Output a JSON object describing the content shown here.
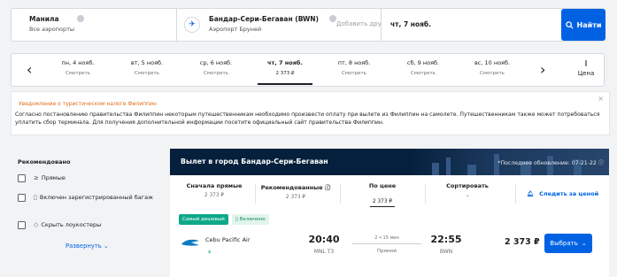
{
  "search": {
    "origin": {
      "city": "Манила",
      "sub": "Все аэропорты"
    },
    "destination": {
      "city": "Бандар-Сери-Бегаван (BWN)",
      "sub": "Аэропорт Бруней"
    },
    "add_placeholder": "Добавить дру",
    "date": "чт, 7 нояб.",
    "button_label": "Найти"
  },
  "date_strip": {
    "days": [
      {
        "date": "пн, 4 нояб.",
        "price": "Смотреть"
      },
      {
        "date": "вт, 5 нояб.",
        "price": "Смотреть"
      },
      {
        "date": "ср, 6 нояб.",
        "price": "Смотреть"
      },
      {
        "date": "чт, 7 нояб.",
        "price": "2 373 ₽"
      },
      {
        "date": "пт, 8 нояб.",
        "price": "Смотреть"
      },
      {
        "date": "сб, 9 нояб.",
        "price": "Смотреть"
      },
      {
        "date": "вс, 10 нояб.",
        "price": "Смотреть"
      }
    ],
    "active_index": 3,
    "price_chart_label": "Цена"
  },
  "notice": {
    "title": "Уведомление о туристическом налоге Филиппин",
    "body": "Согласно постановлению правительства Филиппин некоторым путешественникам необходимо произвести оплату при вылете из Филиппин на самолете. Путешественникам также может потребоваться уплатить сбор терминала. Для получения дополнительной информации посетите официальный сайт правительства Филиппин."
  },
  "filters": {
    "title": "Рекомендовано",
    "items": [
      {
        "label": "Прямые",
        "icon": "direct-flight-icon"
      },
      {
        "label": "Включен зарегистрированный багаж",
        "icon": "luggage-icon"
      },
      {
        "label": "Скрыть лоукостеры",
        "icon": "tag-icon"
      }
    ],
    "expand_label": "Развернуть"
  },
  "results": {
    "banner_title": "Вылет в город Бандар-Сери-Бегаван",
    "last_update": "*Последнее обновление: 07-21-22",
    "sort_tabs": [
      {
        "label": "Сначала прямые",
        "value": "2 373 ₽"
      },
      {
        "label": "Рекомендованные",
        "value": "2 373 ₽"
      },
      {
        "label": "По цене",
        "value": "2 373 ₽"
      },
      {
        "label": "Сортировать",
        "value": ""
      }
    ],
    "active_sort": 2,
    "follow_label": "Следить за ценой",
    "flight": {
      "badges": [
        "Самый дешевый",
        "Включено"
      ],
      "airline": "Cebu Pacific Air",
      "departure_time": "20:40",
      "departure_code": "MNL T3",
      "duration": "2 ч 15 мин",
      "stops": "Прямой",
      "arrival_time": "22:55",
      "arrival_code": "BWN",
      "price": "2 373 ₽",
      "select_label": "Выбрать"
    }
  },
  "colors": {
    "accent": "#0062e3",
    "banner": "#05203c",
    "notice_title": "#e06b17",
    "badge_green": "#0fa88a"
  }
}
